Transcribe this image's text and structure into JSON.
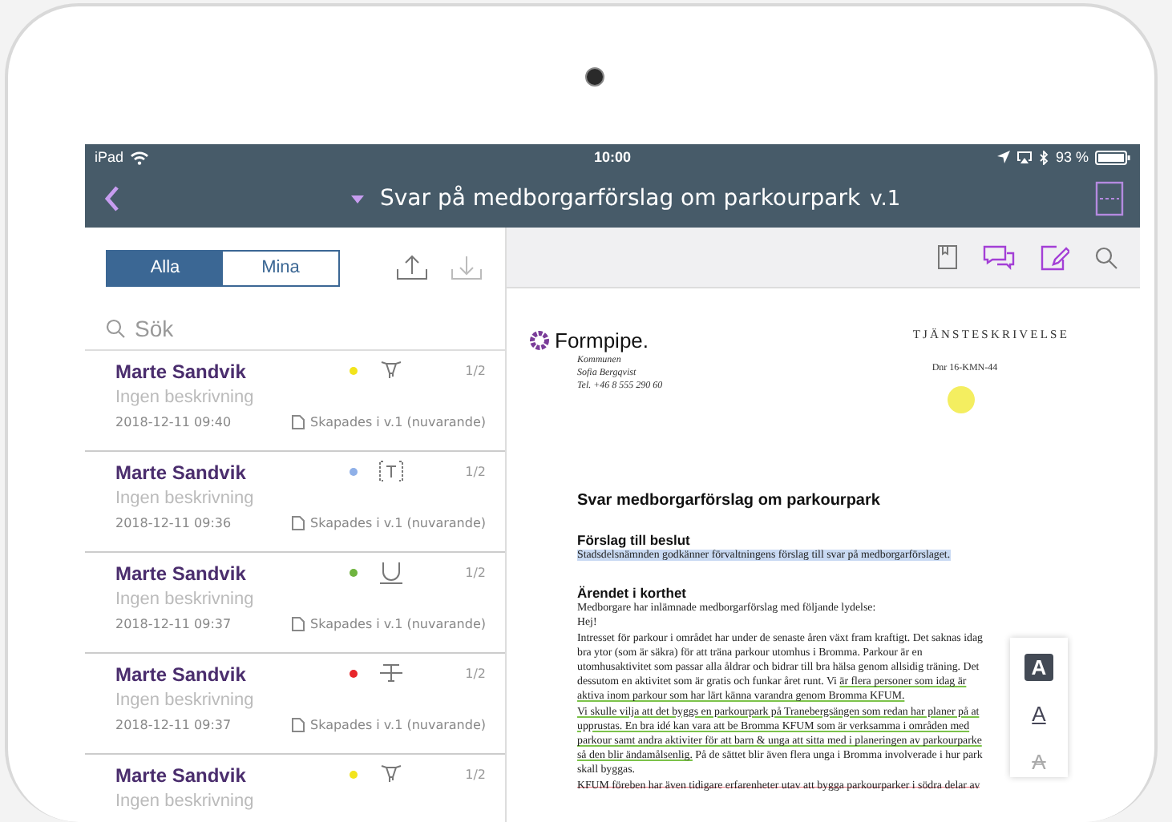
{
  "status_bar": {
    "carrier": "iPad",
    "time": "10:00",
    "battery": "93 %"
  },
  "nav_bar": {
    "title": "Svar på medborgarförslag om parkourpark",
    "version": "v.1"
  },
  "filter_tabs": [
    {
      "label": "Alla",
      "selected": true
    },
    {
      "label": "Mina",
      "selected": false
    }
  ],
  "search": {
    "placeholder": "Sök"
  },
  "annotations": [
    {
      "author": "Marte Sandvik",
      "description": "Ingen beskrivning",
      "color": "#f2e41c",
      "kind": "highlight",
      "page": "1/2",
      "date": "2018-12-11 09:40",
      "version_note": "Skapades i v.1 (nuvarande)"
    },
    {
      "author": "Marte Sandvik",
      "description": "Ingen beskrivning",
      "color": "#8fb0e8",
      "kind": "text",
      "page": "1/2",
      "date": "2018-12-11 09:36",
      "version_note": "Skapades i v.1 (nuvarande)"
    },
    {
      "author": "Marte Sandvik",
      "description": "Ingen beskrivning",
      "color": "#6fb43f",
      "kind": "underline",
      "page": "1/2",
      "date": "2018-12-11 09:37",
      "version_note": "Skapades i v.1 (nuvarande)"
    },
    {
      "author": "Marte Sandvik",
      "description": "Ingen beskrivning",
      "color": "#e8262b",
      "kind": "strikethrough",
      "page": "1/2",
      "date": "2018-12-11 09:37",
      "version_note": "Skapades i v.1 (nuvarande)"
    },
    {
      "author": "Marte Sandvik",
      "description": "Ingen beskrivning",
      "color": "#f2e41c",
      "kind": "highlight",
      "page": "1/2"
    }
  ],
  "document": {
    "company": "Formpipe.",
    "doc_type": "TJÄNSTESKRIVELSE",
    "reference": "Dnr 16-KMN-44",
    "sender_lines": [
      "Kommunen",
      "Sofia Bergqvist",
      "Tel. +46 8 555 290 60"
    ],
    "title": "Svar medborgarförslag om parkourpark",
    "sections": [
      {
        "heading": "Förslag till beslut",
        "lines": [
          [
            {
              "text": "Stadsdelsnämnden godkänner förvaltningens förslag till svar på medborgarförslaget.",
              "kind": "highlight"
            }
          ]
        ]
      },
      {
        "heading": "Ärendet i korthet",
        "lines": [
          [
            {
              "text": "Medborgare har inlämnade medborgarförslag med följande lydelse:",
              "kind": "plain"
            }
          ],
          [
            {
              "text": "Hej!",
              "kind": "plain"
            }
          ],
          [
            {
              "text": "Intresset för parkour i området har under de senaste åren växt fram kraftigt. Det saknas idag",
              "kind": "plain"
            }
          ],
          [
            {
              "text": "bra ytor (som är säkra) för att träna parkour utomhus i Bromma. Parkour är en",
              "kind": "plain"
            }
          ],
          [
            {
              "text": "utomhusaktivitet som passar alla åldrar och bidrar till bra hälsa genom allsidig träning. Det",
              "kind": "plain"
            }
          ],
          [
            {
              "text": "dessutom en aktivitet som är gratis och funkar året runt. Vi ",
              "kind": "plain"
            },
            {
              "text": "är flera personer som idag är",
              "kind": "underline"
            }
          ],
          [
            {
              "text": "aktiva inom parkour som har lärt känna varandra genom Bromma KFUM.",
              "kind": "underline"
            }
          ],
          [
            {
              "text": "Vi skulle vilja att det byggs en parkourpark på Tranebergsängen som redan har planer på at",
              "kind": "underline"
            }
          ],
          [
            {
              "text": "upprustas. En bra idé kan vara att be Bromma KFUM som är verksamma i områden med",
              "kind": "underline"
            }
          ],
          [
            {
              "text": "parkour samt andra aktiviter för att barn & unga att sitta med i planeringen av parkourparke",
              "kind": "underline"
            }
          ],
          [
            {
              "text": "så den blir ändamålsenlig.",
              "kind": "underline"
            },
            {
              "text": " På de sättet blir även flera unga i Bromma involverade i hur park",
              "kind": "plain"
            }
          ],
          [
            {
              "text": "skall byggas.",
              "kind": "plain"
            }
          ],
          [
            {
              "text": "KFUM föreben har även tidigare erfarenheter utav att bygga parkourparker i södra delar av",
              "kind": "strike"
            }
          ]
        ]
      }
    ]
  },
  "format_tools": [
    {
      "kind": "highlight",
      "label": "A"
    },
    {
      "kind": "underline",
      "label": "A"
    },
    {
      "kind": "strikethrough",
      "label": "A"
    }
  ]
}
